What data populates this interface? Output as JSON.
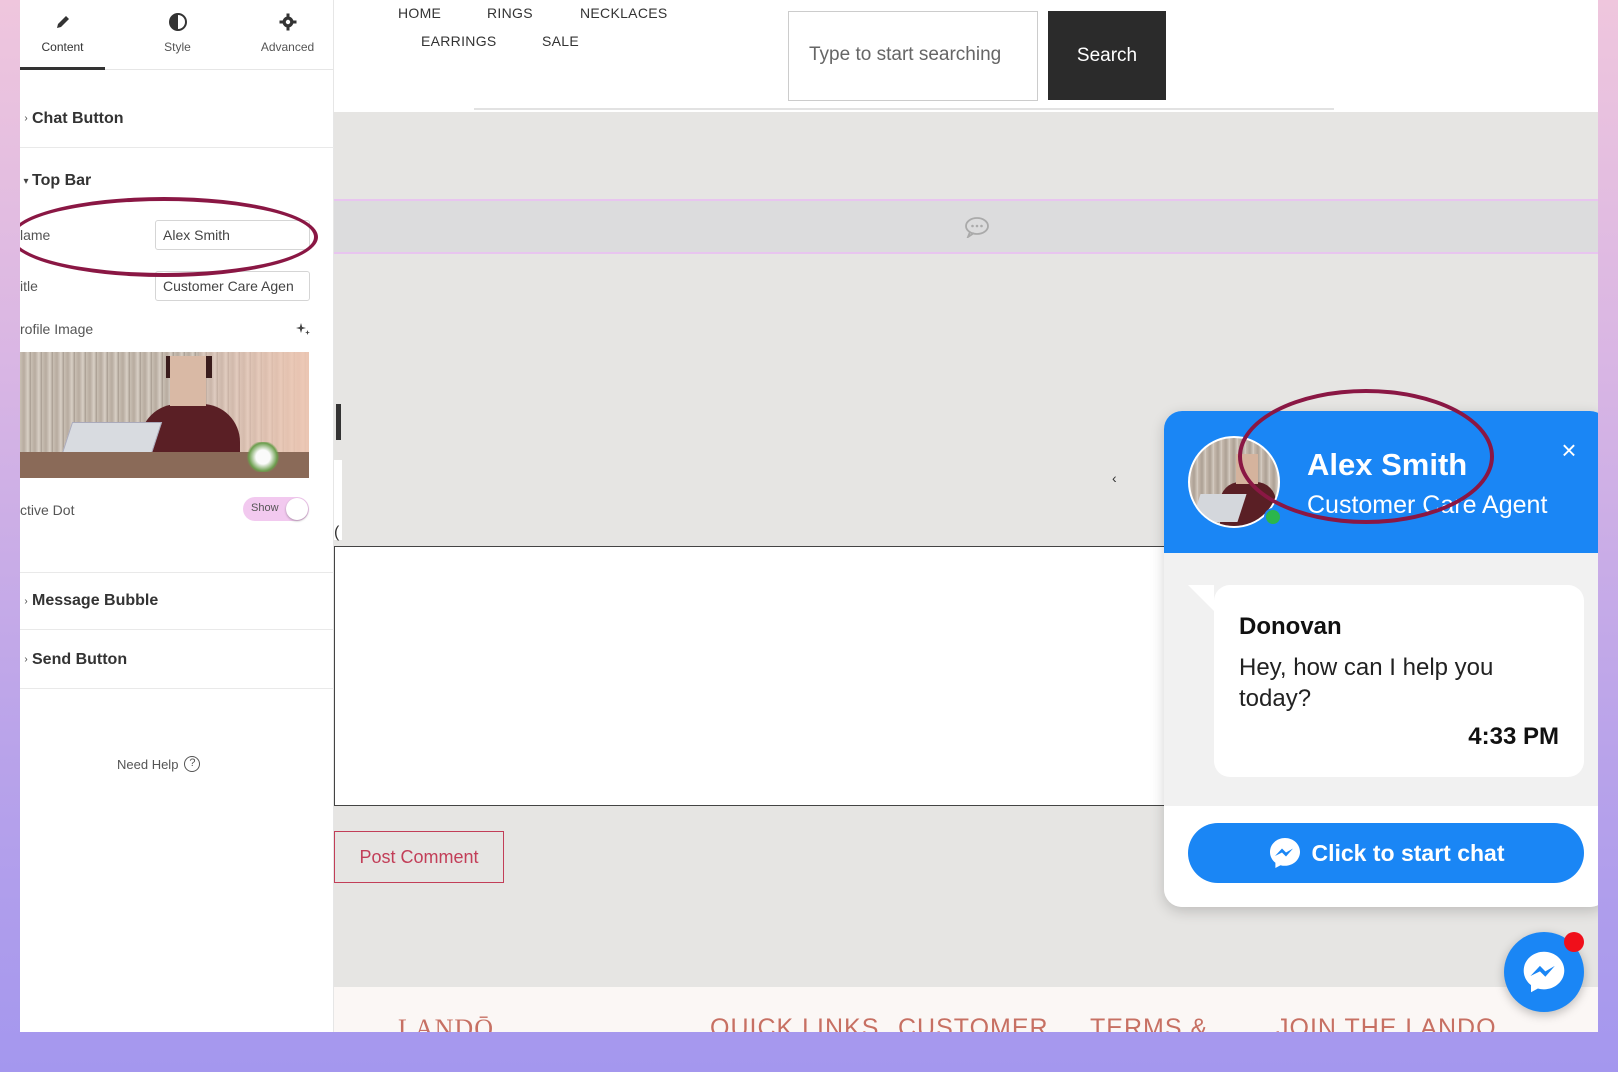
{
  "editor": {
    "tabs": [
      {
        "label": "Content",
        "icon": "pencil-icon"
      },
      {
        "label": "Style",
        "icon": "half-circle-icon"
      },
      {
        "label": "Advanced",
        "icon": "gear-icon"
      }
    ],
    "sections": {
      "chat_button": "Chat Button",
      "top_bar": "Top Bar",
      "message_bubble": "Message Bubble",
      "send_button": "Send Button"
    },
    "fields": {
      "name_label": "lame",
      "name_value": "Alex Smith",
      "title_label": "itle",
      "title_value": "Customer Care Agen",
      "profile_image_label": "rofile Image",
      "active_dot_label": "ctive Dot",
      "active_dot_toggle": "Show"
    },
    "need_help": "Need Help",
    "help_icon_glyph": "?"
  },
  "site": {
    "nav": [
      "HOME",
      "RINGS",
      "NECKLACES",
      "EARRINGS",
      "SALE"
    ],
    "search": {
      "placeholder": "Type to start searching",
      "button": "Search"
    },
    "post_comment": "Post Comment",
    "footer": [
      "LANDŌ",
      "QUICK LINKS",
      "CUSTOMER",
      "TERMS &",
      "JOIN THE LANDO"
    ],
    "stray_glyphs": [
      "‹",
      "("
    ]
  },
  "chat_widget": {
    "agent_name": "Alex Smith",
    "agent_title": "Customer Care Agent",
    "close_glyph": "×",
    "message": {
      "sender": "Donovan",
      "text": "Hey, how can I help you today?",
      "time": "4:33 PM"
    },
    "start_button": "Click to start chat"
  },
  "colors": {
    "chat_blue": "#1a86f5",
    "annotation": "#8a1744",
    "post_comment": "#c23e58",
    "active_dot": "#2bb64c",
    "badge": "#f00f1a"
  }
}
